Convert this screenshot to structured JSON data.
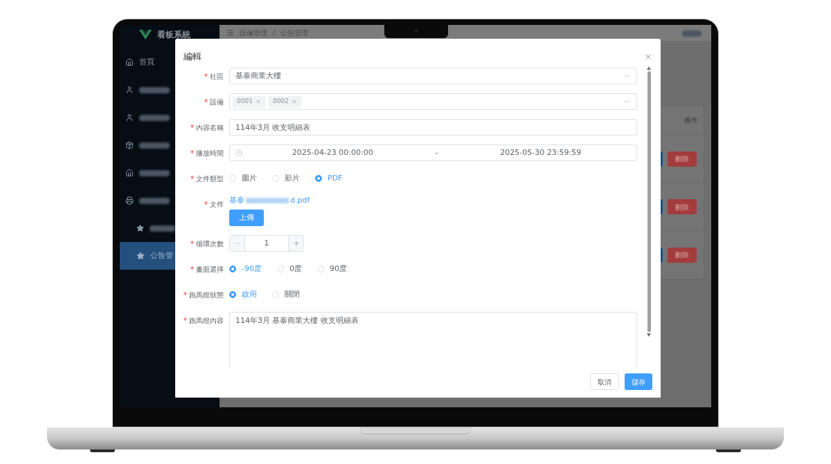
{
  "app": {
    "logo": "看板系統"
  },
  "sidebar": {
    "items": [
      {
        "label": "首頁",
        "selected": false
      },
      {
        "kind": "redacted",
        "selected": false
      },
      {
        "kind": "redacted",
        "selected": false
      },
      {
        "kind": "redacted",
        "selected": false
      },
      {
        "kind": "redacted",
        "selected": false
      },
      {
        "kind": "redacted",
        "selected": false,
        "children": [
          {
            "kind": "redacted",
            "selected": false
          },
          {
            "label": "公告管",
            "selected": true
          }
        ]
      }
    ]
  },
  "breadcrumb": {
    "items": [
      "設備管理",
      "公告管理"
    ],
    "separator": "/"
  },
  "table": {
    "header": "操作",
    "rows": [
      {
        "delete": "刪除"
      },
      {
        "delete": "刪除"
      },
      {
        "delete": "刪除"
      }
    ]
  },
  "dialog": {
    "title": "編輯",
    "fields": [
      {
        "kind": "select",
        "label": "社區",
        "required": true,
        "value": "基泰商業大樓"
      },
      {
        "kind": "tags",
        "label": "設備",
        "required": true,
        "tags": [
          "0001",
          "0002"
        ]
      },
      {
        "kind": "text",
        "label": "內容名稱",
        "required": true,
        "value": "114年3月 收支明細表"
      },
      {
        "kind": "daterange",
        "label": "播放時間",
        "required": true,
        "start": "2025-04-23 00:00:00",
        "separator": "-",
        "end": "2025-05-30 23:59:59"
      },
      {
        "kind": "radio",
        "label": "文件類型",
        "required": true,
        "options": [
          {
            "label": "圖片",
            "selected": false
          },
          {
            "label": "影片",
            "selected": false
          },
          {
            "label": "PDF",
            "selected": true
          }
        ]
      },
      {
        "kind": "file",
        "label": "文件",
        "required": true,
        "file_start": "基泰",
        "file_end": "d.pdf",
        "button": "上傳"
      },
      {
        "kind": "number",
        "label": "循環次數",
        "required": true,
        "value": "1"
      },
      {
        "kind": "radio",
        "label": "畫面選擇",
        "required": true,
        "options": [
          {
            "label": "-90度",
            "selected": true
          },
          {
            "label": "0度",
            "selected": false
          },
          {
            "label": "90度",
            "selected": false
          }
        ]
      },
      {
        "kind": "radio",
        "label": "跑馬燈狀態",
        "required": true,
        "options": [
          {
            "label": "啟用",
            "selected": true
          },
          {
            "label": "關閉",
            "selected": false
          }
        ]
      },
      {
        "kind": "textarea",
        "label": "跑馬燈內容",
        "required": true,
        "value": "114年3月 基泰商業大樓 收支明細表"
      }
    ],
    "buttons": [
      {
        "label": "取消",
        "kind": "default"
      },
      {
        "label": "儲存",
        "kind": "primary"
      }
    ]
  }
}
